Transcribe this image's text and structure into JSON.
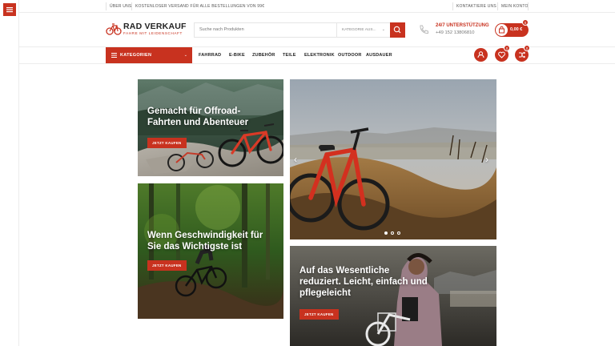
{
  "topbar": {
    "about": "ÜBER UNS",
    "shipping": "KOSTENLOSER VERSAND FÜR ALLE BESTELLUNGEN VON 99€",
    "contact": "KONTAKTIERE UNS",
    "account": "MEIN KONTO"
  },
  "header": {
    "logo_name": "RAD VERKAUF",
    "logo_tagline": "FAHRE MIT LEIDENSCHAFT",
    "search_placeholder": "Suche nach Produkten",
    "search_category": "KATEGORIE AUS...",
    "support_title": "24/7 UNTERSTÜTZUNG",
    "support_phone": "+49 152 13806810",
    "cart_total": "0,00 €",
    "cart_count": "0"
  },
  "nav": {
    "categories_label": "KATEGORIEN",
    "items": [
      "FAHRRAD",
      "E-BIKE",
      "ZUBEHÖR",
      "TEILE",
      "ELEKTRONIK",
      "OUTDOOR",
      "AUSDAUER"
    ],
    "wishlist_count": "0",
    "compare_count": "0"
  },
  "banners": {
    "offroad": {
      "title": "Gemacht für Offroad-Fahrten und Abenteuer",
      "button": "JETZT KAUFEN"
    },
    "speed": {
      "title": "Wenn Geschwindigkeit für Sie das Wichtigste ist",
      "button": "JETZT KAUFEN"
    },
    "essential": {
      "title": "Auf das Wesentliche reduziert. Leicht, einfach und pflegeleicht",
      "button": "JETZT KAUFEN"
    }
  },
  "slider": {
    "slide_count": 3,
    "active_slide": 1
  },
  "icons": {
    "side_menu": "hamburger-icon",
    "search": "search-icon",
    "support": "phone-icon",
    "cart": "shopping-bag-icon",
    "account": "user-icon",
    "wishlist": "heart-icon",
    "compare": "shuffle-icon",
    "prev": "chevron-left-icon",
    "next": "chevron-right-icon"
  },
  "colors": {
    "accent": "#c8321f",
    "text": "#222222",
    "border": "#ececec"
  }
}
